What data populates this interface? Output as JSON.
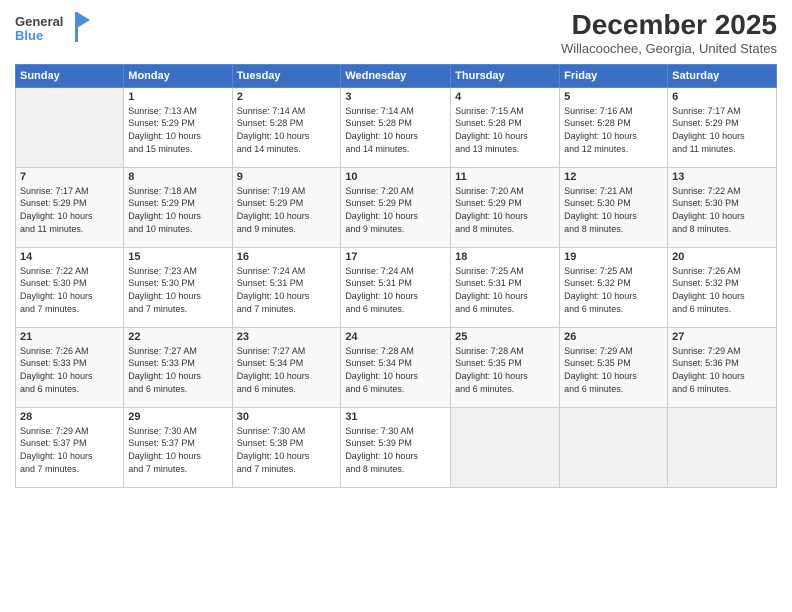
{
  "header": {
    "logo_general": "General",
    "logo_blue": "Blue",
    "title": "December 2025",
    "location": "Willacoochee, Georgia, United States"
  },
  "weekdays": [
    "Sunday",
    "Monday",
    "Tuesday",
    "Wednesday",
    "Thursday",
    "Friday",
    "Saturday"
  ],
  "weeks": [
    [
      {
        "day": "",
        "content": ""
      },
      {
        "day": "1",
        "content": "Sunrise: 7:13 AM\nSunset: 5:29 PM\nDaylight: 10 hours\nand 15 minutes."
      },
      {
        "day": "2",
        "content": "Sunrise: 7:14 AM\nSunset: 5:28 PM\nDaylight: 10 hours\nand 14 minutes."
      },
      {
        "day": "3",
        "content": "Sunrise: 7:14 AM\nSunset: 5:28 PM\nDaylight: 10 hours\nand 14 minutes."
      },
      {
        "day": "4",
        "content": "Sunrise: 7:15 AM\nSunset: 5:28 PM\nDaylight: 10 hours\nand 13 minutes."
      },
      {
        "day": "5",
        "content": "Sunrise: 7:16 AM\nSunset: 5:28 PM\nDaylight: 10 hours\nand 12 minutes."
      },
      {
        "day": "6",
        "content": "Sunrise: 7:17 AM\nSunset: 5:29 PM\nDaylight: 10 hours\nand 11 minutes."
      }
    ],
    [
      {
        "day": "7",
        "content": "Sunrise: 7:17 AM\nSunset: 5:29 PM\nDaylight: 10 hours\nand 11 minutes."
      },
      {
        "day": "8",
        "content": "Sunrise: 7:18 AM\nSunset: 5:29 PM\nDaylight: 10 hours\nand 10 minutes."
      },
      {
        "day": "9",
        "content": "Sunrise: 7:19 AM\nSunset: 5:29 PM\nDaylight: 10 hours\nand 9 minutes."
      },
      {
        "day": "10",
        "content": "Sunrise: 7:20 AM\nSunset: 5:29 PM\nDaylight: 10 hours\nand 9 minutes."
      },
      {
        "day": "11",
        "content": "Sunrise: 7:20 AM\nSunset: 5:29 PM\nDaylight: 10 hours\nand 8 minutes."
      },
      {
        "day": "12",
        "content": "Sunrise: 7:21 AM\nSunset: 5:30 PM\nDaylight: 10 hours\nand 8 minutes."
      },
      {
        "day": "13",
        "content": "Sunrise: 7:22 AM\nSunset: 5:30 PM\nDaylight: 10 hours\nand 8 minutes."
      }
    ],
    [
      {
        "day": "14",
        "content": "Sunrise: 7:22 AM\nSunset: 5:30 PM\nDaylight: 10 hours\nand 7 minutes."
      },
      {
        "day": "15",
        "content": "Sunrise: 7:23 AM\nSunset: 5:30 PM\nDaylight: 10 hours\nand 7 minutes."
      },
      {
        "day": "16",
        "content": "Sunrise: 7:24 AM\nSunset: 5:31 PM\nDaylight: 10 hours\nand 7 minutes."
      },
      {
        "day": "17",
        "content": "Sunrise: 7:24 AM\nSunset: 5:31 PM\nDaylight: 10 hours\nand 6 minutes."
      },
      {
        "day": "18",
        "content": "Sunrise: 7:25 AM\nSunset: 5:31 PM\nDaylight: 10 hours\nand 6 minutes."
      },
      {
        "day": "19",
        "content": "Sunrise: 7:25 AM\nSunset: 5:32 PM\nDaylight: 10 hours\nand 6 minutes."
      },
      {
        "day": "20",
        "content": "Sunrise: 7:26 AM\nSunset: 5:32 PM\nDaylight: 10 hours\nand 6 minutes."
      }
    ],
    [
      {
        "day": "21",
        "content": "Sunrise: 7:26 AM\nSunset: 5:33 PM\nDaylight: 10 hours\nand 6 minutes."
      },
      {
        "day": "22",
        "content": "Sunrise: 7:27 AM\nSunset: 5:33 PM\nDaylight: 10 hours\nand 6 minutes."
      },
      {
        "day": "23",
        "content": "Sunrise: 7:27 AM\nSunset: 5:34 PM\nDaylight: 10 hours\nand 6 minutes."
      },
      {
        "day": "24",
        "content": "Sunrise: 7:28 AM\nSunset: 5:34 PM\nDaylight: 10 hours\nand 6 minutes."
      },
      {
        "day": "25",
        "content": "Sunrise: 7:28 AM\nSunset: 5:35 PM\nDaylight: 10 hours\nand 6 minutes."
      },
      {
        "day": "26",
        "content": "Sunrise: 7:29 AM\nSunset: 5:35 PM\nDaylight: 10 hours\nand 6 minutes."
      },
      {
        "day": "27",
        "content": "Sunrise: 7:29 AM\nSunset: 5:36 PM\nDaylight: 10 hours\nand 6 minutes."
      }
    ],
    [
      {
        "day": "28",
        "content": "Sunrise: 7:29 AM\nSunset: 5:37 PM\nDaylight: 10 hours\nand 7 minutes."
      },
      {
        "day": "29",
        "content": "Sunrise: 7:30 AM\nSunset: 5:37 PM\nDaylight: 10 hours\nand 7 minutes."
      },
      {
        "day": "30",
        "content": "Sunrise: 7:30 AM\nSunset: 5:38 PM\nDaylight: 10 hours\nand 7 minutes."
      },
      {
        "day": "31",
        "content": "Sunrise: 7:30 AM\nSunset: 5:39 PM\nDaylight: 10 hours\nand 8 minutes."
      },
      {
        "day": "",
        "content": ""
      },
      {
        "day": "",
        "content": ""
      },
      {
        "day": "",
        "content": ""
      }
    ]
  ]
}
